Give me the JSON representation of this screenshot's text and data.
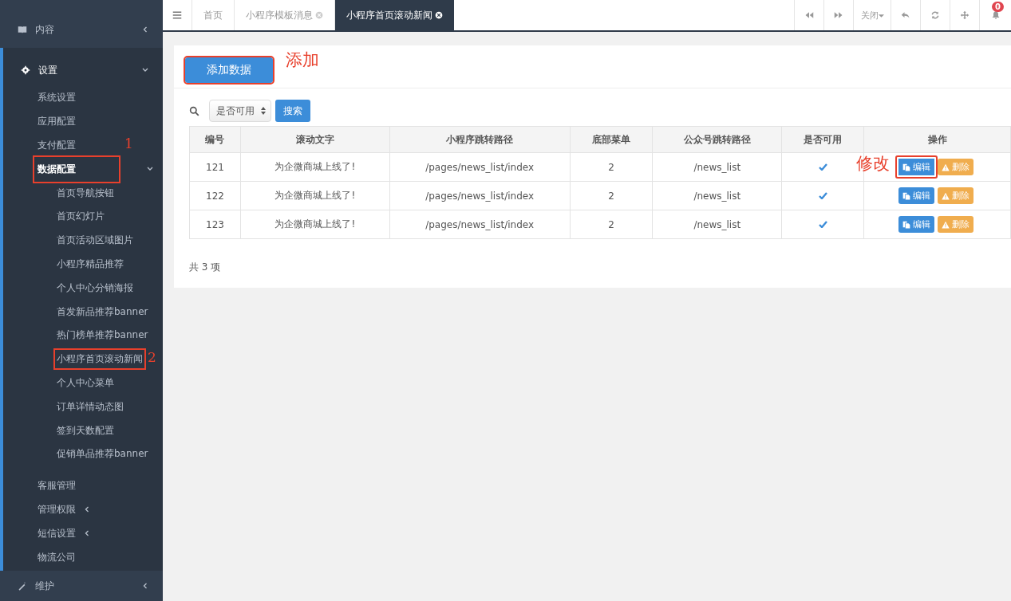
{
  "sidebar": {
    "items": [
      {
        "label": "内容",
        "expanded": false
      },
      {
        "label": "设置",
        "expanded": true,
        "children": [
          {
            "label": "系统设置"
          },
          {
            "label": "应用配置"
          },
          {
            "label": "支付配置",
            "note": "1"
          },
          {
            "label": "数据配置",
            "expanded": true,
            "highlighted": true,
            "children": [
              {
                "label": "首页导航按钮",
                "highlighted": false
              },
              {
                "label": "首页幻灯片",
                "highlighted": false
              },
              {
                "label": "首页活动区域图片",
                "highlighted": false
              },
              {
                "label": "小程序精品推荐",
                "highlighted": false
              },
              {
                "label": "个人中心分销海报",
                "highlighted": false
              },
              {
                "label": "首发新品推荐banner",
                "highlighted": false
              },
              {
                "label": "热门榜单推荐banner",
                "highlighted": false
              },
              {
                "label": "小程序首页滚动新闻",
                "highlighted": true,
                "note": "2"
              },
              {
                "label": "个人中心菜单",
                "highlighted": false
              },
              {
                "label": "订单详情动态图",
                "highlighted": false
              },
              {
                "label": "签到天数配置",
                "highlighted": false
              },
              {
                "label": "促销单品推荐banner",
                "highlighted": false
              }
            ]
          },
          {
            "label": "客服管理"
          },
          {
            "label": "管理权限",
            "expanded": false
          },
          {
            "label": "短信设置",
            "expanded": false
          },
          {
            "label": "物流公司"
          }
        ]
      },
      {
        "label": "维护",
        "expanded": false
      }
    ]
  },
  "tabs": [
    {
      "label": "首页",
      "selected": false,
      "closable": false
    },
    {
      "label": "小程序模板消息",
      "selected": false,
      "closable": true
    },
    {
      "label": "小程序首页滚动新闻",
      "selected": true,
      "closable": true
    }
  ],
  "toolbar": [
    {
      "kind": "rewind"
    },
    {
      "kind": "forward"
    },
    {
      "kind": "dropdown",
      "label": "关闭"
    },
    {
      "kind": "reply"
    },
    {
      "kind": "refresh"
    },
    {
      "kind": "move"
    },
    {
      "kind": "bell",
      "badge": "0"
    }
  ],
  "add_button": {
    "label": "添加数据",
    "highlighted": true,
    "note": "添加"
  },
  "filter": {
    "select": "是否可用",
    "search_button": "搜索"
  },
  "table": {
    "columns": [
      "编号",
      "滚动文字",
      "小程序跳转路径",
      "底部菜单",
      "公众号跳转路径",
      "是否可用",
      "操作"
    ],
    "rows": [
      {
        "id": "121",
        "text": "为企微商城上线了!",
        "path": "/pages/news_list/index",
        "menu": "2",
        "mp_path": "/news_list",
        "enabled": true,
        "edit": "编辑",
        "delete": "删除",
        "highlighted": true,
        "note": "修改"
      },
      {
        "id": "122",
        "text": "为企微商城上线了!",
        "path": "/pages/news_list/index",
        "menu": "2",
        "mp_path": "/news_list",
        "enabled": true,
        "edit": "编辑",
        "delete": "删除",
        "highlighted": false
      },
      {
        "id": "123",
        "text": "为企微商城上线了!",
        "path": "/pages/news_list/index",
        "menu": "2",
        "mp_path": "/news_list",
        "enabled": true,
        "edit": "编辑",
        "delete": "删除",
        "highlighted": false
      }
    ]
  },
  "footer": "共 3 项"
}
